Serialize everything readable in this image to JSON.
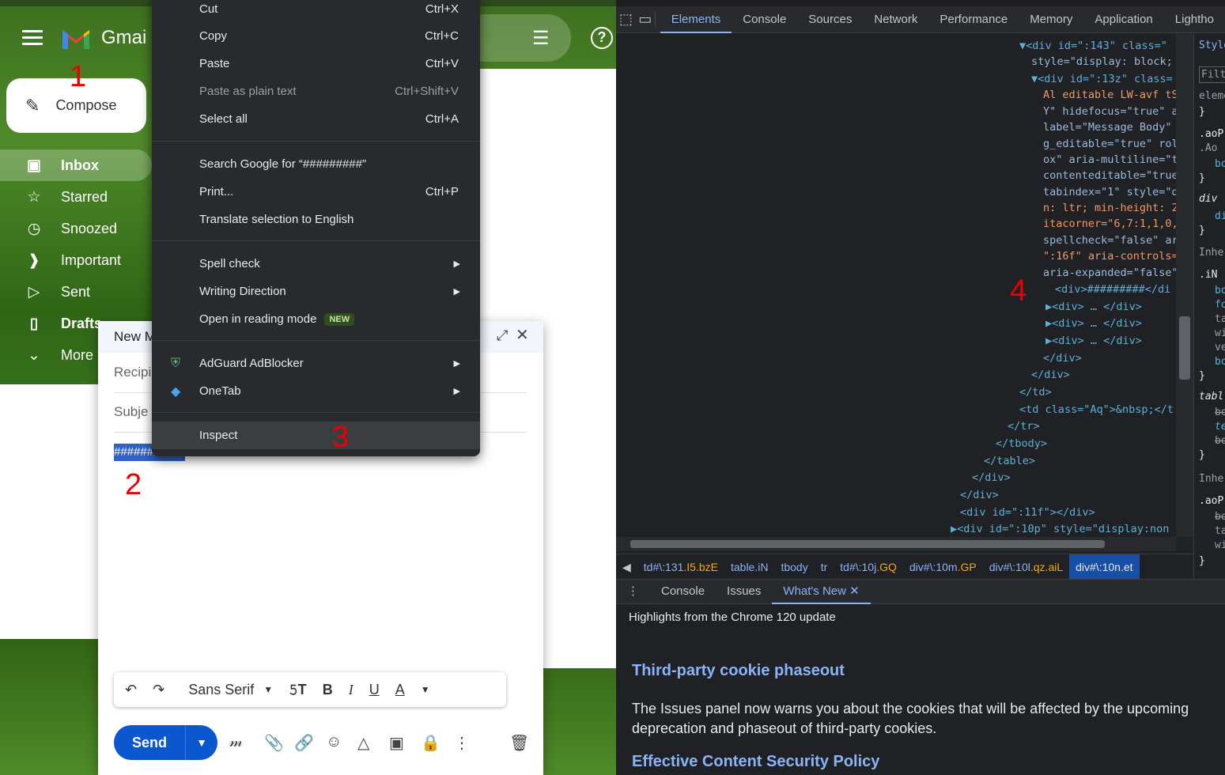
{
  "gmail": {
    "app_name": "Gmai",
    "compose_label": "Compose",
    "nav": [
      {
        "label": "Inbox",
        "icon": "inbox-icon"
      },
      {
        "label": "Starred",
        "icon": "star-icon"
      },
      {
        "label": "Snoozed",
        "icon": "clock-icon"
      },
      {
        "label": "Important",
        "icon": "important-icon"
      },
      {
        "label": "Sent",
        "icon": "send-icon"
      },
      {
        "label": "Drafts",
        "icon": "draft-icon"
      },
      {
        "label": "More",
        "icon": "chevron-down-icon"
      }
    ],
    "compose_window": {
      "title": "New M",
      "recipients_placeholder": "Recipi",
      "subject_placeholder": "Subje",
      "selected_text": "#########",
      "font_name": "Sans Serif",
      "send_label": "Send"
    },
    "annotations": [
      "1",
      "2",
      "3",
      "4"
    ]
  },
  "context_menu": {
    "items": [
      {
        "label": "Cut",
        "shortcut": "Ctrl+X"
      },
      {
        "label": "Copy",
        "shortcut": "Ctrl+C"
      },
      {
        "label": "Paste",
        "shortcut": "Ctrl+V"
      },
      {
        "label": "Paste as plain text",
        "shortcut": "Ctrl+Shift+V",
        "disabled": true
      },
      {
        "label": "Select all",
        "shortcut": "Ctrl+A"
      },
      {
        "label": "Search Google for “#########”"
      },
      {
        "label": "Print...",
        "shortcut": "Ctrl+P"
      },
      {
        "label": "Translate selection to English"
      },
      {
        "label": "Spell check",
        "submenu": true
      },
      {
        "label": "Writing Direction",
        "submenu": true
      },
      {
        "label": "Open in reading mode",
        "badge": "NEW"
      },
      {
        "label": "AdGuard AdBlocker",
        "submenu": true,
        "icon": "adguard-shield-icon"
      },
      {
        "label": "OneTab",
        "submenu": true,
        "icon": "onetab-diamond-icon"
      },
      {
        "label": "Inspect",
        "highlighted": true
      }
    ]
  },
  "devtools": {
    "tabs": [
      "Elements",
      "Console",
      "Sources",
      "Network",
      "Performance",
      "Memory",
      "Application",
      "Lightho"
    ],
    "active_tab": "Elements",
    "code_lines": [
      "▼<div id=\":143\" class=\"",
      "style=\"display: block;",
      "▼<div id=\":13z\" class=",
      "Al editable LW-avf tS",
      "Y\" hidefocus=\"true\" a",
      "label=\"Message Body\"",
      "g_editable=\"true\" rol",
      "ox\" aria-multiline=\"t",
      "contenteditable=\"true",
      "tabindex=\"1\" style=\"d",
      "n: ltr; min-height: 2",
      "itacorner=\"6,7:1,1,0,",
      "spellcheck=\"false\" ar",
      "\":16f\" aria-controls=",
      "aria-expanded=\"false\"",
      "<div>#########</di",
      "▶<div> … </div>",
      "▶<div> … </div>",
      "▶<div> … </div>",
      "</div>",
      "</div>",
      "</td>",
      "<td class=\"Aq\">&nbsp;</t",
      "</tr>",
      "</tbody>",
      "</table>",
      "</div>",
      "</div>",
      "<div id=\":11f\"></div>",
      "▶<div id=\":10p\" style=\"display:non"
    ],
    "breadcrumbs": [
      {
        "el": "td#\\:131",
        "cls": ".I5.bzE"
      },
      {
        "el": "table",
        "cls": ".iN"
      },
      {
        "el": "tbody",
        "cls": ""
      },
      {
        "el": "tr",
        "cls": ""
      },
      {
        "el": "td#\\:10j",
        "cls": ".GQ"
      },
      {
        "el": "div#\\:10m",
        "cls": ".GP"
      },
      {
        "el": "div#\\:10l",
        "cls": ".qz.aiL"
      },
      {
        "el": "div#\\:10n",
        "cls": ".et"
      }
    ],
    "styles_tab": "Style",
    "styles_filter": "Filter",
    "styles_lines": [
      "eleme",
      "}",
      ".aoP",
      ".Ao",
      "bo",
      "}",
      "div",
      "di",
      "}",
      "Inher",
      ".iN",
      "bo",
      "fo",
      "ta",
      "wi",
      "ve",
      "bo",
      "}",
      "tabl",
      "bo",
      "te",
      "bo",
      "}",
      "Inher",
      ".aoP",
      "bo",
      "ta",
      "wi",
      "}"
    ],
    "drawer_tabs": [
      "Console",
      "Issues",
      "What's New"
    ],
    "drawer": {
      "highlight": "Highlights from the Chrome 120 update",
      "heading1": "Third-party cookie phaseout",
      "paragraph": "The Issues panel now warns you about the cookies that will be affected by the upcoming deprecation and phaseout of third-party cookies.",
      "heading2": "Effective Content Security Policy"
    }
  }
}
